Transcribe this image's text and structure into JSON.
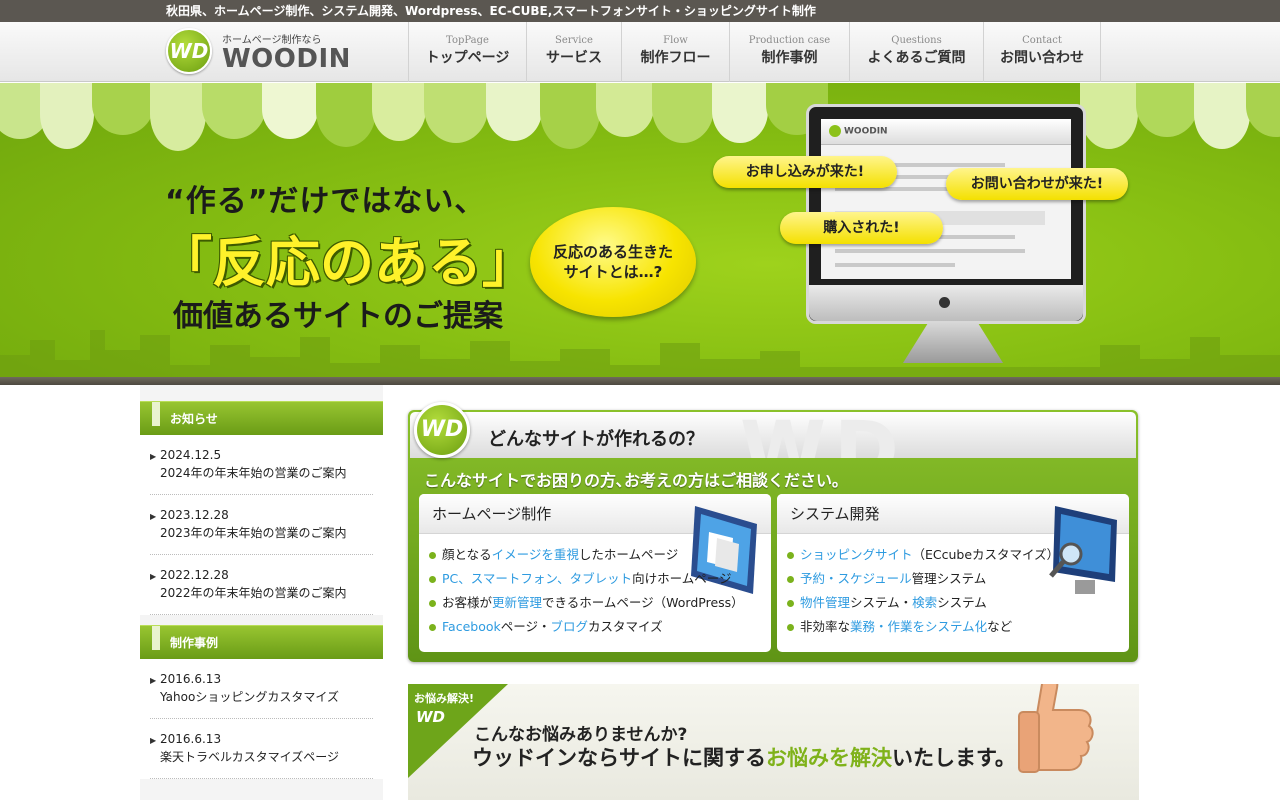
{
  "topbar": {
    "text": "秋田県、ホームページ制作、システム開発、Wordpress、EC-CUBE,スマートフォンサイト・ショッピングサイト制作"
  },
  "logo": {
    "mark": "WD",
    "sub": "ホームページ制作なら",
    "name": "WOODIN"
  },
  "nav": [
    {
      "en": "TopPage",
      "ja": "トップページ"
    },
    {
      "en": "Service",
      "ja": "サービス"
    },
    {
      "en": "Flow",
      "ja": "制作フロー"
    },
    {
      "en": "Production case",
      "ja": "制作事例"
    },
    {
      "en": "Questions",
      "ja": "よくあるご質問"
    },
    {
      "en": "Contact",
      "ja": "お問い合わせ"
    }
  ],
  "hero": {
    "line1": "“作る”だけではない、",
    "line2": "「反応のある」",
    "line3": "価値あるサイトのご提案",
    "bubble": "反応のある生きた\nサイトとは…?",
    "balloons": [
      "お申し込みが来た!",
      "お問い合わせが来た!",
      "購入された!"
    ],
    "screen_logo": "WOODIN"
  },
  "sidebar": {
    "news_title": "お知らせ",
    "news": [
      {
        "date": "2024.12.5",
        "title": "2024年の年末年始の営業のご案内"
      },
      {
        "date": "2023.12.28",
        "title": "2023年の年末年始の営業のご案内"
      },
      {
        "date": "2022.12.28",
        "title": "2022年の年末年始の営業のご案内"
      }
    ],
    "works_title": "制作事例",
    "works": [
      {
        "date": "2016.6.13",
        "title": "Yahooショッピングカスタマイズ"
      },
      {
        "date": "2016.6.13",
        "title": "楽天トラベルカスタマイズページ"
      }
    ]
  },
  "main": {
    "badge": "WD",
    "watermark": "WD",
    "title": "どんなサイトが作れるの？",
    "subtitle": "こんなサイトでお困りの方､お考えの方はご相談ください｡",
    "panels": [
      {
        "title": "ホームページ制作",
        "items": [
          [
            [
              "顔となる",
              false
            ],
            [
              "イメージを重視",
              true
            ],
            [
              "したホームページ",
              false
            ]
          ],
          [
            [
              "PC、スマートフォン、タブレット",
              true
            ],
            [
              "向けホームページ",
              false
            ]
          ],
          [
            [
              "お客様が",
              false
            ],
            [
              "更新管理",
              true
            ],
            [
              "できるホームページ（WordPress）",
              false
            ]
          ],
          [
            [
              "Facebook",
              true
            ],
            [
              "ページ・",
              false
            ],
            [
              "ブログ",
              true
            ],
            [
              "カスタマイズ",
              false
            ]
          ]
        ]
      },
      {
        "title": "システム開発",
        "items": [
          [
            [
              "ショッピングサイト",
              true
            ],
            [
              "（ECcubeカスタマイズ）",
              false
            ]
          ],
          [
            [
              "予約・スケジュール",
              true
            ],
            [
              "管理システム",
              false
            ]
          ],
          [
            [
              "物件管理",
              true
            ],
            [
              "システム・",
              false
            ],
            [
              "検索",
              true
            ],
            [
              "システム",
              false
            ]
          ],
          [
            [
              "非効率な",
              false
            ],
            [
              "業務・作業をシステム化",
              true
            ],
            [
              "など",
              false
            ]
          ]
        ]
      }
    ]
  },
  "banner": {
    "flag_text": "お悩み解決!",
    "flag_mark": "WD",
    "question": "こんなお悩みありませんか?",
    "main_pre": "ウッドインならサイトに関する",
    "main_em": "お悩みを解決",
    "main_post": "いたします。"
  },
  "colors": {
    "brand_green": "#7bb21c",
    "link_blue": "#2e9be0",
    "balloon_yellow": "#f4e000",
    "topbar": "#5b5751"
  }
}
